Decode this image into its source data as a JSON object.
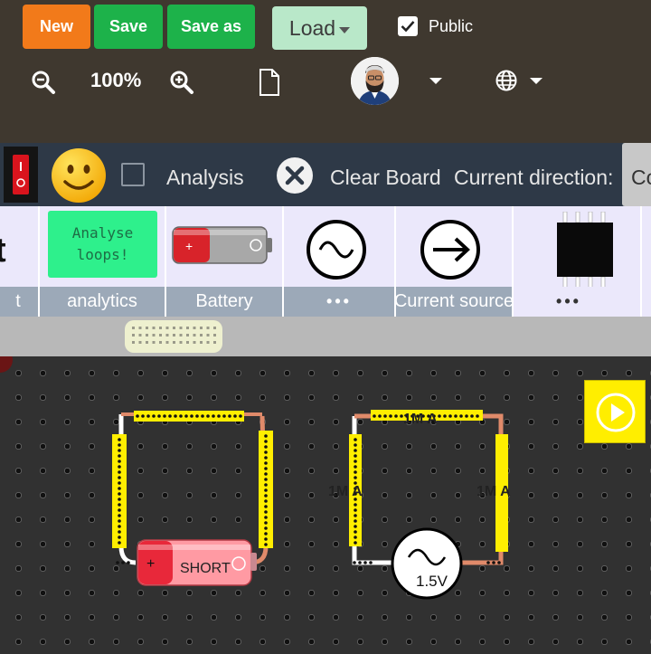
{
  "toolbar": {
    "new_label": "New",
    "save_label": "Save",
    "save_as_label": "Save as",
    "load_label": "Load",
    "public_label": "Public",
    "public_checked": true,
    "zoom_level": "100%"
  },
  "controls": {
    "analysis_label": "Analysis",
    "clear_board_label": "Clear Board",
    "current_direction_label": "Current direction:",
    "tab_partial_label": "Co"
  },
  "palette": {
    "partial_first": {
      "glyph": "t",
      "label": "t"
    },
    "items": [
      {
        "label": "analytics",
        "text_line1": "Analyse",
        "text_line2": "loops!"
      },
      {
        "label": "Battery"
      },
      {
        "label": "•••"
      },
      {
        "label": "Current source"
      },
      {
        "label": "•••"
      }
    ]
  },
  "board": {
    "battery_label": "SHORT",
    "ac_source_label": "1.5V",
    "current_labels": [
      "1M A",
      "1M A",
      "1M A"
    ]
  },
  "colors": {
    "new": "#f27a1a",
    "save": "#1db24a",
    "load": "#b9e8c9",
    "toolbar_bg": "#3f382f",
    "control_bg": "#2e3947",
    "palette_bg": "#ebe8fb",
    "palette_label_bg": "#9ca9b8",
    "wire_highlight": "#ffee00",
    "run_button": "#ffee00"
  }
}
